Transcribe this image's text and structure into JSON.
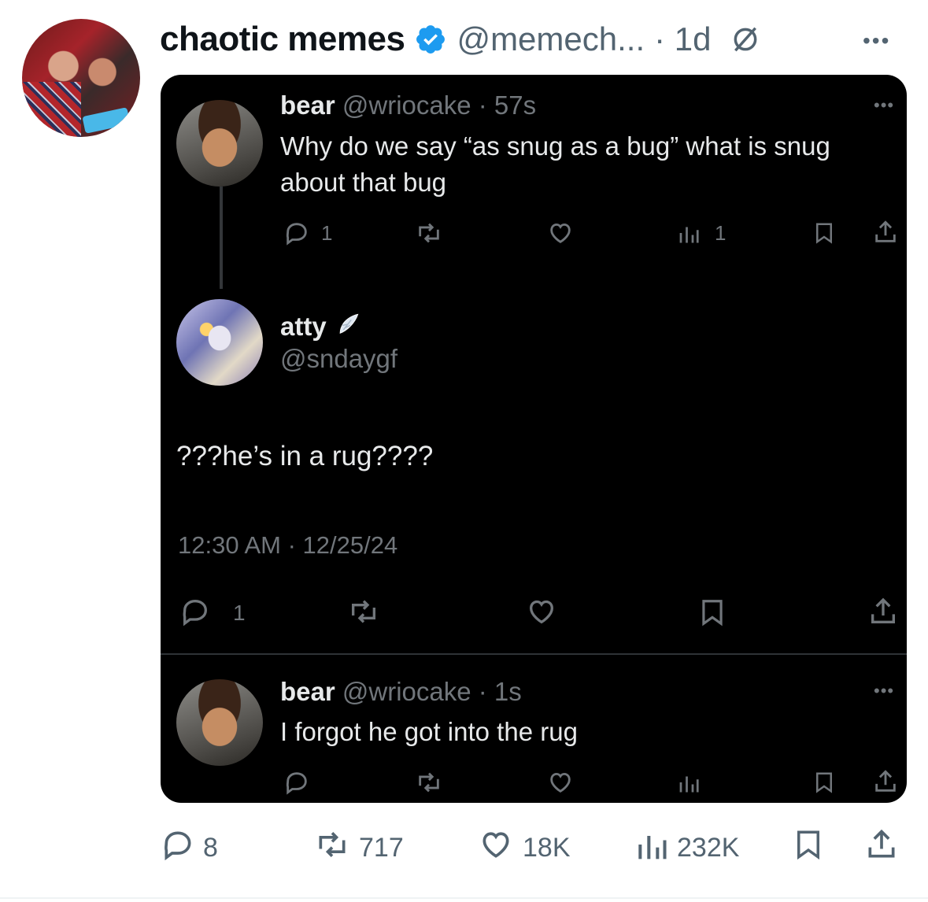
{
  "post": {
    "author_name": "chaotic memes",
    "handle": "@memech...",
    "time": "· 1d",
    "more": "•••",
    "verified_color": "#1d9bf0",
    "icons": {
      "verified": "verified-badge-icon",
      "grok": "grok-icon",
      "more": "more-icon"
    }
  },
  "screenshot": {
    "tweet1": {
      "name": "bear",
      "handle_time": "@wriocake · 57s",
      "line1": "Why do we say “as snug as a bug” what is snug",
      "line2": "about that bug",
      "reply_count": "1",
      "views_count": "1",
      "more": "•••"
    },
    "tweet2": {
      "name": "atty",
      "handle": "@sndaygf",
      "text": "???he’s in a rug????",
      "timestamp": "12:30 AM · 12/25/24",
      "reply_count": "1"
    },
    "tweet3": {
      "name": "bear",
      "handle_time": "@wriocake · 1s",
      "text": "I forgot he got into the rug",
      "more": "•••"
    }
  },
  "actions": {
    "replies": "8",
    "reposts": "717",
    "likes": "18K",
    "views": "232K"
  }
}
